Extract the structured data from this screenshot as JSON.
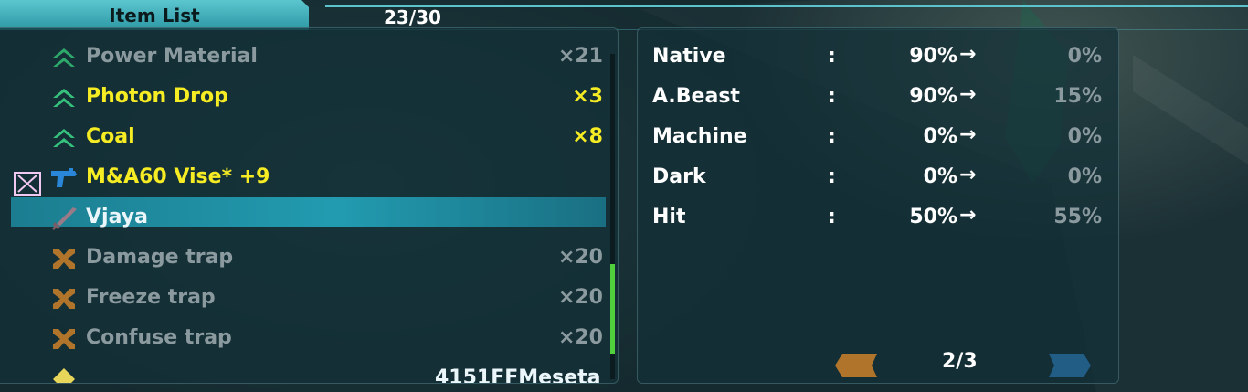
{
  "header": {
    "title": "Item List",
    "count": "23/30"
  },
  "items": [
    {
      "name": "Power Material",
      "qty": "×21",
      "color": "grey",
      "icon": "chevron-up-double-icon"
    },
    {
      "name": "Photon Drop",
      "qty": "×3",
      "color": "yellow",
      "icon": "chevron-up-double-icon"
    },
    {
      "name": "Coal",
      "qty": "×8",
      "color": "yellow",
      "icon": "chevron-up-double-icon"
    },
    {
      "name": "M&A60 Vise* +9",
      "qty": "",
      "color": "yellow",
      "icon": "handgun-icon"
    },
    {
      "name": "Vjaya",
      "qty": "",
      "color": "white",
      "icon": "sword-icon"
    },
    {
      "name": "Damage trap",
      "qty": "×20",
      "color": "grey",
      "icon": "trap-x-icon"
    },
    {
      "name": "Freeze trap",
      "qty": "×20",
      "color": "grey",
      "icon": "trap-x-icon"
    },
    {
      "name": "Confuse trap",
      "qty": "×20",
      "color": "grey",
      "icon": "trap-x-icon"
    },
    {
      "name": "4151FFMeseta",
      "qty": "",
      "color": "white",
      "icon": "meseta-icon"
    }
  ],
  "selected_index": 4,
  "scroll_fraction": 0.75,
  "stats": [
    {
      "label": "Native",
      "colon": ":",
      "current": "90%",
      "arrow": "→",
      "next": "0%"
    },
    {
      "label": "A.Beast",
      "colon": ":",
      "current": "90%",
      "arrow": "→",
      "next": "15%"
    },
    {
      "label": "Machine",
      "colon": ":",
      "current": "0%",
      "arrow": "→",
      "next": "0%"
    },
    {
      "label": "Dark",
      "colon": ":",
      "current": "0%",
      "arrow": "→",
      "next": "0%"
    },
    {
      "label": "Hit",
      "colon": ":",
      "current": "50%",
      "arrow": "→",
      "next": "55%"
    }
  ],
  "pager": {
    "text": "2/3"
  },
  "colors": {
    "accent": "#3fb6c1",
    "yellow_text": "#f6ec24",
    "grey_text": "#8b9a9f",
    "selection": "#229bb0",
    "scroll": "#4fd03c",
    "prev_button": "#b0752a",
    "next_button": "#225d86"
  }
}
